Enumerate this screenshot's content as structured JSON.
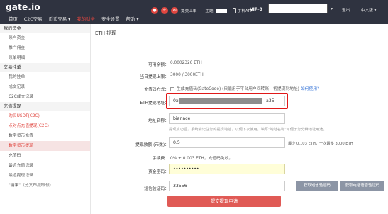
{
  "header": {
    "logo": "gate.io",
    "nav": [
      "首页",
      "C2C交易",
      "币币交易 ▾",
      "我的财务",
      "安全设置",
      "帮助 ▾"
    ],
    "active_nav_index": 3,
    "submit_ticket": "提交工单",
    "theme_label": "主题",
    "mobile_app": "手机APP",
    "vip": "VIP-0",
    "logout": "退出",
    "language": "中文版 ▾",
    "bg_color": "#2f3340",
    "accent_color": "#e0463f"
  },
  "sidebar": {
    "sections": [
      {
        "title": "我的资金",
        "items": [
          {
            "label": "账户资金",
            "style": "normal"
          },
          {
            "label": "推广佣金",
            "style": "normal"
          },
          {
            "label": "账单明细",
            "style": "normal"
          }
        ]
      },
      {
        "title": "交易挂单",
        "items": [
          {
            "label": "我的挂单",
            "style": "normal"
          },
          {
            "label": "成交记录",
            "style": "normal"
          },
          {
            "label": "C2C成交记录",
            "style": "normal"
          }
        ]
      },
      {
        "title": "充值提现",
        "items": [
          {
            "label": "购买USDT(C2C)",
            "style": "red"
          },
          {
            "label": "点对点充值提现(C2C)",
            "style": "red"
          },
          {
            "label": "数字货币充值",
            "style": "normal"
          },
          {
            "label": "数字货币提现",
            "style": "selected"
          },
          {
            "label": "充值码",
            "style": "normal"
          },
          {
            "label": "最近充值记录",
            "style": "normal"
          },
          {
            "label": "最近提现记录",
            "style": "normal"
          },
          {
            "label": "\"糖果\"（分叉币提取领）",
            "style": "normal"
          }
        ]
      }
    ]
  },
  "main": {
    "title": "ETH 提现",
    "available_label": "可用余额：",
    "available_value": "0.0002326 ETH",
    "daily_limit_label": "当日提现上限：",
    "daily_limit_value": "3000 / 3000ETH",
    "method_label": "充值码方式：",
    "method_text": "生成充值码(GateCode) (只能用于平台用户间转账，初提现到地址)",
    "method_link": "如何使用?",
    "address_label": "ETH提现地址：",
    "address_prefix": "0xe",
    "address_suffix": "a35",
    "name_label": "地址名称：",
    "name_value": "bianace",
    "name_hint": "提现成功后，系统会记住您的提现地址，以便下次使用。填写\"地址名称\"可便于您分辨地址用途。",
    "amount_label": "提现数额 (币数)：",
    "amount_value": "0.5",
    "amount_hint": "最少 0.103 ETH，一次最多 3000 ETH",
    "fee_label": "手续费：",
    "fee_value": "0% + 0.003 ETH，充值码免收。",
    "fund_pwd_label": "资金密码：",
    "fund_pwd_value": "••••••••••",
    "sms_label": "短信验证码：",
    "sms_value": "33556",
    "sms_button1": "获取短信验证码",
    "sms_button2": "获取电话语音验证码",
    "submit": "提交提现申请",
    "highlight_color": "#e01919"
  }
}
